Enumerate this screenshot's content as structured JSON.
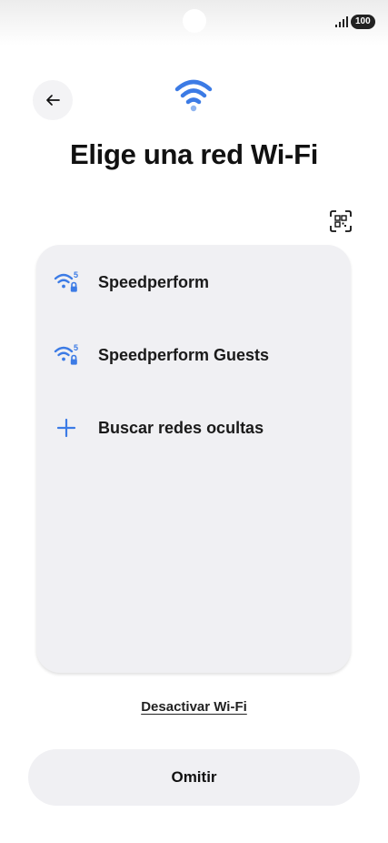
{
  "status_bar": {
    "battery": "100",
    "icons": [
      "signal-icon",
      "battery-icon"
    ]
  },
  "header": {
    "title": "Elige una red Wi-Fi",
    "icons": [
      "back-arrow-icon",
      "wifi-icon",
      "qr-code-scan-icon"
    ]
  },
  "networks": [
    {
      "name": "Speedperform",
      "icon": "wifi-5ghz-lock-icon"
    },
    {
      "name": "Speedperform Guests",
      "icon": "wifi-5ghz-lock-icon"
    }
  ],
  "hidden_networks": {
    "label": "Buscar redes ocultas",
    "icon": "plus-icon"
  },
  "footer": {
    "deactivate_label": "Desactivar Wi-Fi",
    "skip_label": "Omitir"
  },
  "colors": {
    "accent": "#3c7be5",
    "card_background": "#f0f0f3",
    "title_text": "#111111"
  }
}
